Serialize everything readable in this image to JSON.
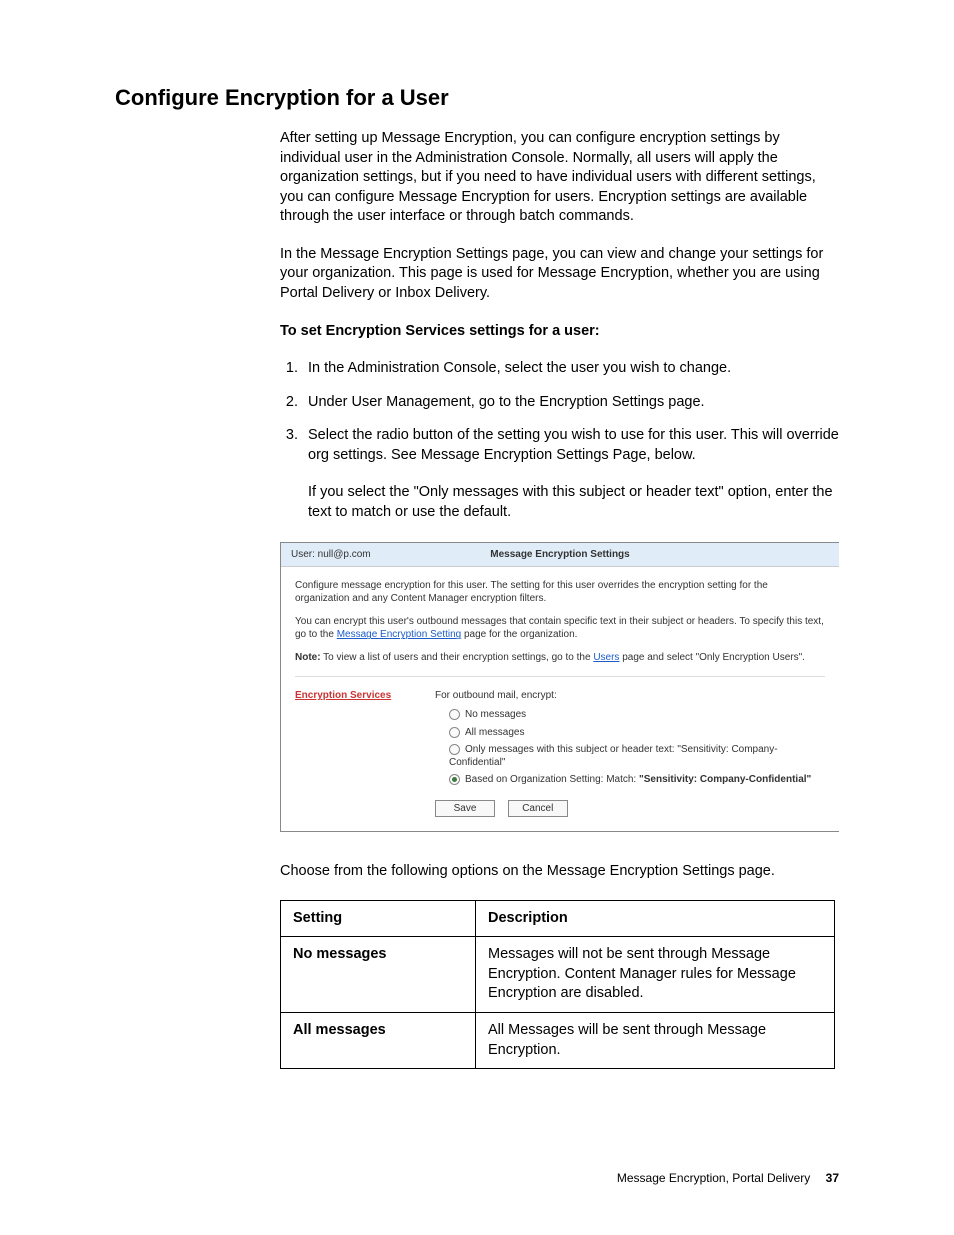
{
  "heading": "Configure Encryption for a User",
  "intro_para1": "After setting up Message Encryption, you can configure encryption settings by individual user in the Administration Console. Normally, all users will apply the organization settings, but if you need to have individual users with different settings, you can configure Message Encryption for users. Encryption settings are available through the user interface or through batch commands.",
  "intro_para2": "In the Message Encryption Settings page, you can view and change your settings for your organization. This page is used for Message Encryption, whether you are using Portal Delivery or Inbox Delivery.",
  "procedure_title": "To set Encryption Services settings for a user:",
  "steps": [
    "In the Administration Console, select the user you wish to change.",
    "Under User Management, go to the Encryption Settings page.",
    "Select the radio button of the setting you wish to use for this user. This will override org settings. See Message Encryption Settings Page, below."
  ],
  "step3_note": "If you select the \"Only messages with this subject or header text\" option, enter the text to match or use the default.",
  "figure": {
    "user_label": "User: null@p.com",
    "panel_title": "Message Encryption Settings",
    "desc1": "Configure message encryption for this user. The setting for this user overrides the encryption setting for the organization and any Content Manager encryption filters.",
    "desc2_a": "You can encrypt this user's outbound messages that contain specific text in their subject or headers. To specify this text, go to the",
    "desc2_link": "Message Encryption Setting",
    "desc2_b": " page for the organization.",
    "desc3_a": "Note:",
    "desc3_b": " To view a list of users and their encryption settings, go to the ",
    "desc3_link": "Users",
    "desc3_c": " page and select \"Only Encryption Users\".",
    "section_label": "Encryption Services",
    "options_header": "For outbound mail, encrypt:",
    "radios": {
      "r1": "No messages",
      "r2": "All messages",
      "r3": "Only messages with this subject or header text: \"Sensitivity: Company-Confidential\"",
      "r4_a": "Based on Organization Setting: Match: ",
      "r4_b": "\"Sensitivity: Company-Confidential\""
    },
    "save": "Save",
    "cancel": "Cancel"
  },
  "post_fig_para": "Choose from the following options on the Message Encryption Settings page.",
  "table": {
    "h1": "Setting",
    "h2": "Description",
    "rows": [
      {
        "setting": "No messages",
        "desc": "Messages will not be sent through Message Encryption. Content Manager rules for Message Encryption are disabled."
      },
      {
        "setting": "All messages",
        "desc": "All Messages will be sent through Message Encryption."
      }
    ]
  },
  "footer_text": "Message Encryption, Portal Delivery",
  "page_number": "37"
}
